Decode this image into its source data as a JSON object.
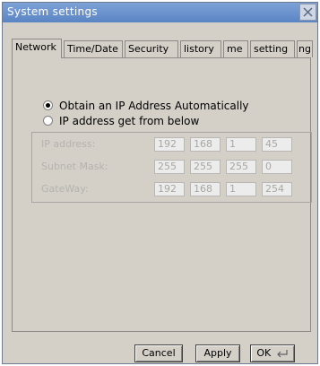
{
  "window": {
    "title": "System settings"
  },
  "tabs": [
    {
      "label": "Network"
    },
    {
      "label": "Time/Date"
    },
    {
      "label": "Security"
    },
    {
      "label": "listory"
    },
    {
      "label": "me"
    },
    {
      "label": "setting"
    },
    {
      "label": "ng"
    }
  ],
  "ip_mode": {
    "auto_label": "Obtain an IP Address Automatically",
    "manual_label": "IP address get from below",
    "selected": "auto"
  },
  "fields": [
    {
      "label": "IP address:",
      "octets": [
        "192",
        "168",
        "1",
        "45"
      ]
    },
    {
      "label": "Subnet Mask:",
      "octets": [
        "255",
        "255",
        "255",
        "0"
      ]
    },
    {
      "label": "GateWay:",
      "octets": [
        "192",
        "168",
        "1",
        "254"
      ]
    }
  ],
  "buttons": {
    "cancel": "Cancel",
    "apply": "Apply",
    "ok": "OK"
  },
  "colors": {
    "titlebar": "#5a84c4",
    "window_bg": "#d4d0c8"
  }
}
